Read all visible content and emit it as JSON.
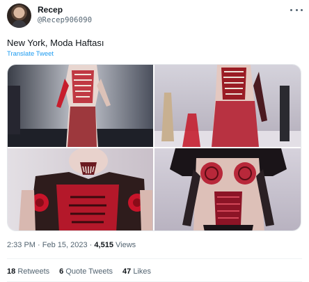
{
  "author": {
    "name": "Recep",
    "handle": "@Recep906090"
  },
  "tweet": {
    "text": "New York, Moda Haftası",
    "translate_label": "Translate Tweet"
  },
  "media": {
    "image_count": 4,
    "images": [
      "runway-look-1",
      "runway-look-2",
      "runway-look-3",
      "runway-look-4"
    ]
  },
  "meta": {
    "time": "2:33 PM",
    "separator": "·",
    "date": "Feb 15, 2023",
    "views_count": "4,515",
    "views_label": "Views"
  },
  "stats": {
    "retweets_count": "18",
    "retweets_label": "Retweets",
    "quotes_count": "6",
    "quotes_label": "Quote Tweets",
    "likes_count": "47",
    "likes_label": "Likes"
  },
  "colors": {
    "link": "#1d9bf0",
    "text": "#0f1419",
    "secondary": "#536471"
  }
}
